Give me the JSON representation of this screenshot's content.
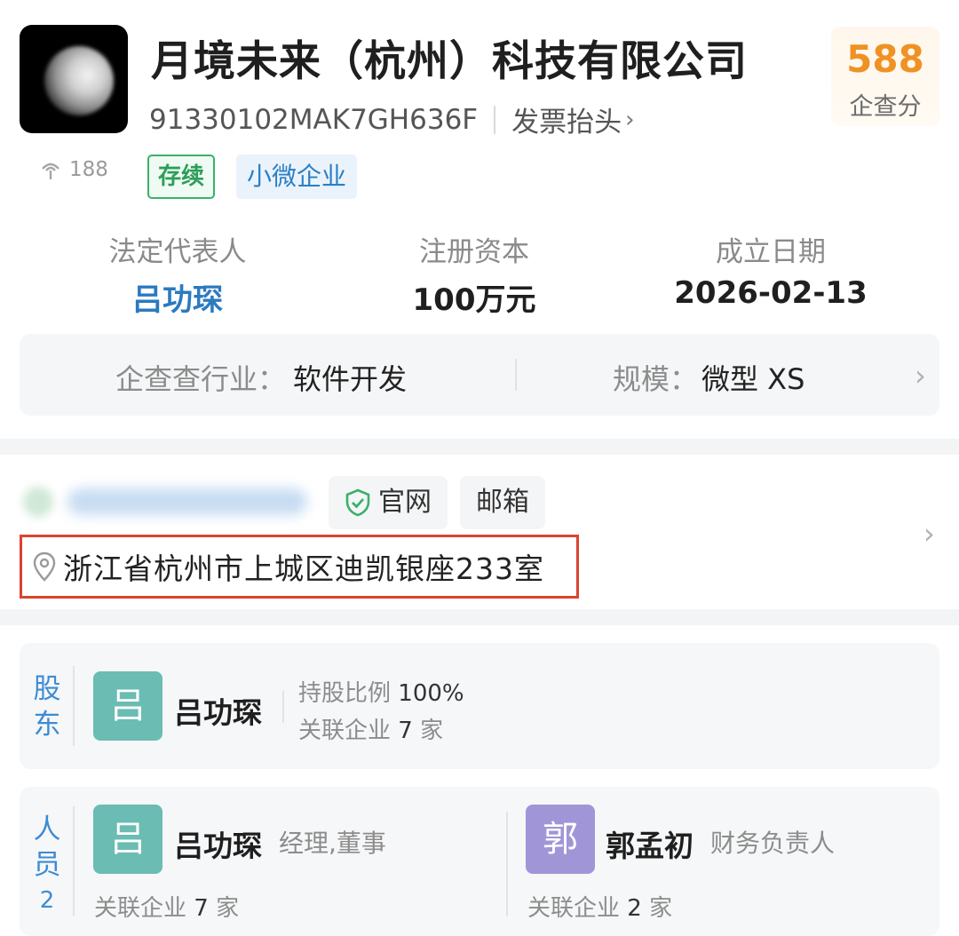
{
  "header": {
    "company_name": "月境未来（杭州）科技有限公司",
    "credit_code": "91330102MAK7GH636F",
    "invoice_link": "发票抬头",
    "score_value": "588",
    "score_label": "企查分",
    "hot_count": "188",
    "tags": [
      "存续",
      "小微企业"
    ]
  },
  "stats": [
    {
      "label": "法定代表人",
      "value": "吕功琛"
    },
    {
      "label": "注册资本",
      "value": "100万元"
    },
    {
      "label": "成立日期",
      "value": "2026-02-13"
    }
  ],
  "industry": {
    "label": "企查查行业：",
    "value": "软件开发",
    "scale_label": "规模：",
    "scale_value": "微型 XS"
  },
  "contact": {
    "website_label": "官网",
    "email_label": "邮箱",
    "address": "浙江省杭州市上城区迪凯银座233室"
  },
  "shareholder": {
    "section_label": [
      "股",
      "东"
    ],
    "avatar_char": "吕",
    "name": "吕功琛",
    "ratio_label": "持股比例",
    "ratio_value": "100%",
    "related_label": "关联企业",
    "related_count": "7",
    "related_unit": "家"
  },
  "personnel": {
    "section_label": [
      "人",
      "员"
    ],
    "count": "2",
    "people": [
      {
        "avatar_char": "吕",
        "name": "吕功琛",
        "role": "经理,董事",
        "related_label": "关联企业",
        "related_count": "7",
        "related_unit": "家"
      },
      {
        "avatar_char": "郭",
        "name": "郭孟初",
        "role": "财务负责人",
        "related_label": "关联企业",
        "related_count": "2",
        "related_unit": "家"
      }
    ]
  },
  "colors": {
    "score": "#f09223",
    "link_blue": "#2b7ac0",
    "status_green": "#2e9d5a",
    "highlight_red": "#d9442e",
    "avatar_teal": "#6bbcb3",
    "avatar_purple": "#a096d7"
  },
  "icons": [
    "company-logo",
    "fire-icon",
    "chevron-right-icon",
    "phone-icon",
    "shield-check-icon",
    "location-pin-icon"
  ]
}
